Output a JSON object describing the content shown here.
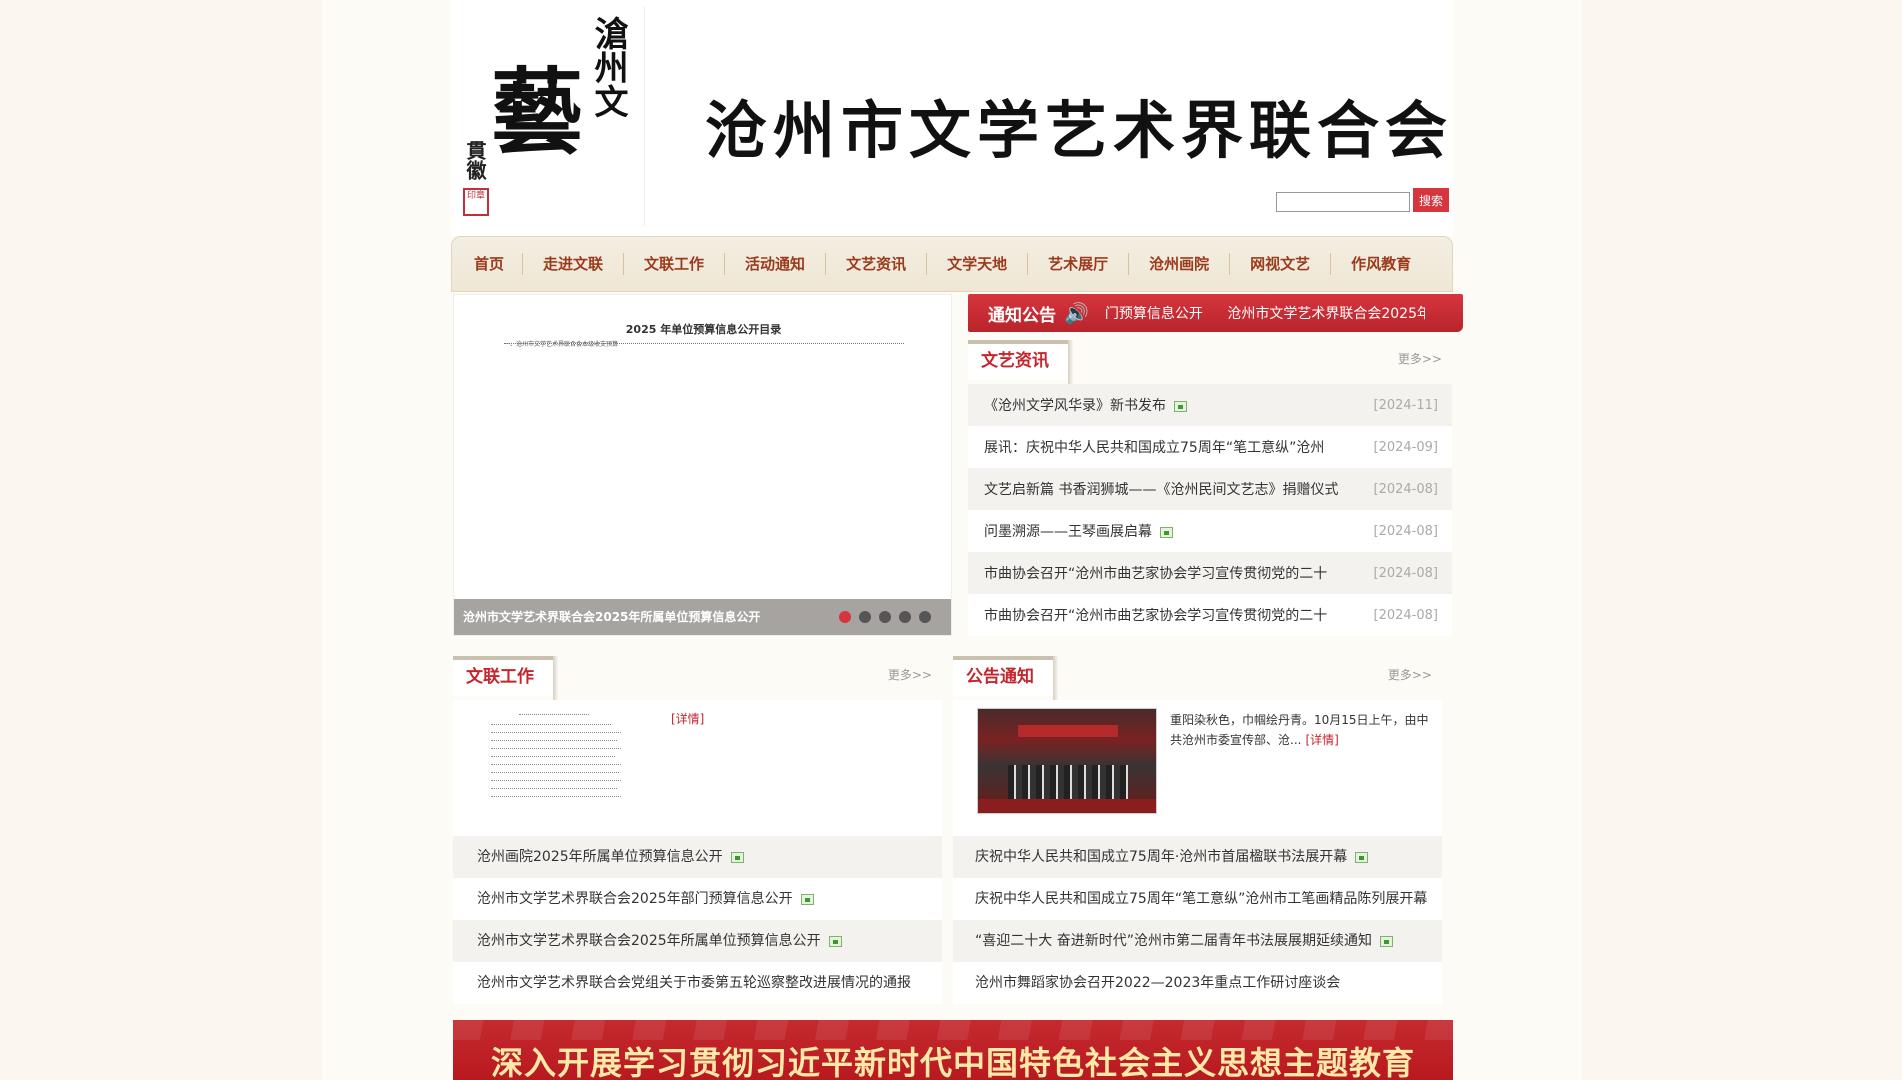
{
  "header": {
    "logo_main": "藝",
    "logo_vertical": "滄州文",
    "logo_signature": "貫徽",
    "logo_seal": "印章",
    "site_title": "沧州市文学艺术界联合会",
    "search_placeholder": "",
    "search_button": "搜索"
  },
  "nav": {
    "items": [
      {
        "label": "首页"
      },
      {
        "label": "走进文联"
      },
      {
        "label": "文联工作"
      },
      {
        "label": "活动通知"
      },
      {
        "label": "文艺资讯"
      },
      {
        "label": "文学天地"
      },
      {
        "label": "艺术展厅"
      },
      {
        "label": "沧州画院"
      },
      {
        "label": "网视文艺"
      },
      {
        "label": "作风教育"
      }
    ]
  },
  "slider": {
    "doc_title": "2025 年单位预算信息公开目录",
    "doc_sub": "一、沧州市文学艺术界联合会本级收支预算",
    "caption": "沧州市文学艺术界联合会2025年所属单位预算信息公开",
    "dots": 5,
    "active_dot": 0
  },
  "notice": {
    "title": "通知公告",
    "marquee": [
      "门预算信息公开",
      "沧州市文学艺术界联合会2025年"
    ]
  },
  "news": {
    "title": "文艺资讯",
    "more": "更多>>",
    "items": [
      {
        "title": "《沧州文学风华录》新书发布",
        "date": "[2024-11]",
        "new": true
      },
      {
        "title": "展讯：庆祝中华人民共和国成立75周年“笔工意纵”沧州",
        "date": "[2024-09]",
        "new": false
      },
      {
        "title": "文艺启新篇 书香润狮城——《沧州民间文艺志》捐赠仪式",
        "date": "[2024-08]",
        "new": false
      },
      {
        "title": "问墨溯源——王琴画展启幕",
        "date": "[2024-08]",
        "new": true
      },
      {
        "title": "市曲协会召开“沧州市曲艺家协会学习宣传贯彻党的二十",
        "date": "[2024-08]",
        "new": false
      },
      {
        "title": "市曲协会召开“沧州市曲艺家协会学习宣传贯彻党的二十",
        "date": "[2024-08]",
        "new": false
      }
    ]
  },
  "work": {
    "title": "文联工作",
    "more": "更多>>",
    "detail": "[详情]",
    "items": [
      {
        "title": "沧州画院2025年所属单位预算信息公开",
        "new": true
      },
      {
        "title": "沧州市文学艺术界联合会2025年部门预算信息公开",
        "new": true
      },
      {
        "title": "沧州市文学艺术界联合会2025年所属单位预算信息公开",
        "new": true
      },
      {
        "title": "沧州市文学艺术界联合会党组关于市委第五轮巡察整改进展情况的通报",
        "new": false
      }
    ]
  },
  "announcement": {
    "title": "公告通知",
    "more": "更多>>",
    "summary": "重阳染秋色，巾帼绘丹青。10月15日上午，由中共沧州市委宣传部、沧...",
    "detail": "[详情]",
    "items": [
      {
        "title": "庆祝中华人民共和国成立75周年·沧州市首届楹联书法展开幕",
        "new": true
      },
      {
        "title": "庆祝中华人民共和国成立75周年“笔工意纵”沧州市工笔画精品陈列展开幕",
        "new": false
      },
      {
        "title": "“喜迎二十大 奋进新时代”沧州市第二届青年书法展展期延续通知",
        "new": true
      },
      {
        "title": "沧州市舞蹈家协会召开2022—2023年重点工作研讨座谈会",
        "new": false
      }
    ]
  },
  "banner": {
    "text": "深入开展学习贯彻习近平新时代中国特色社会主义思想主题教育"
  }
}
